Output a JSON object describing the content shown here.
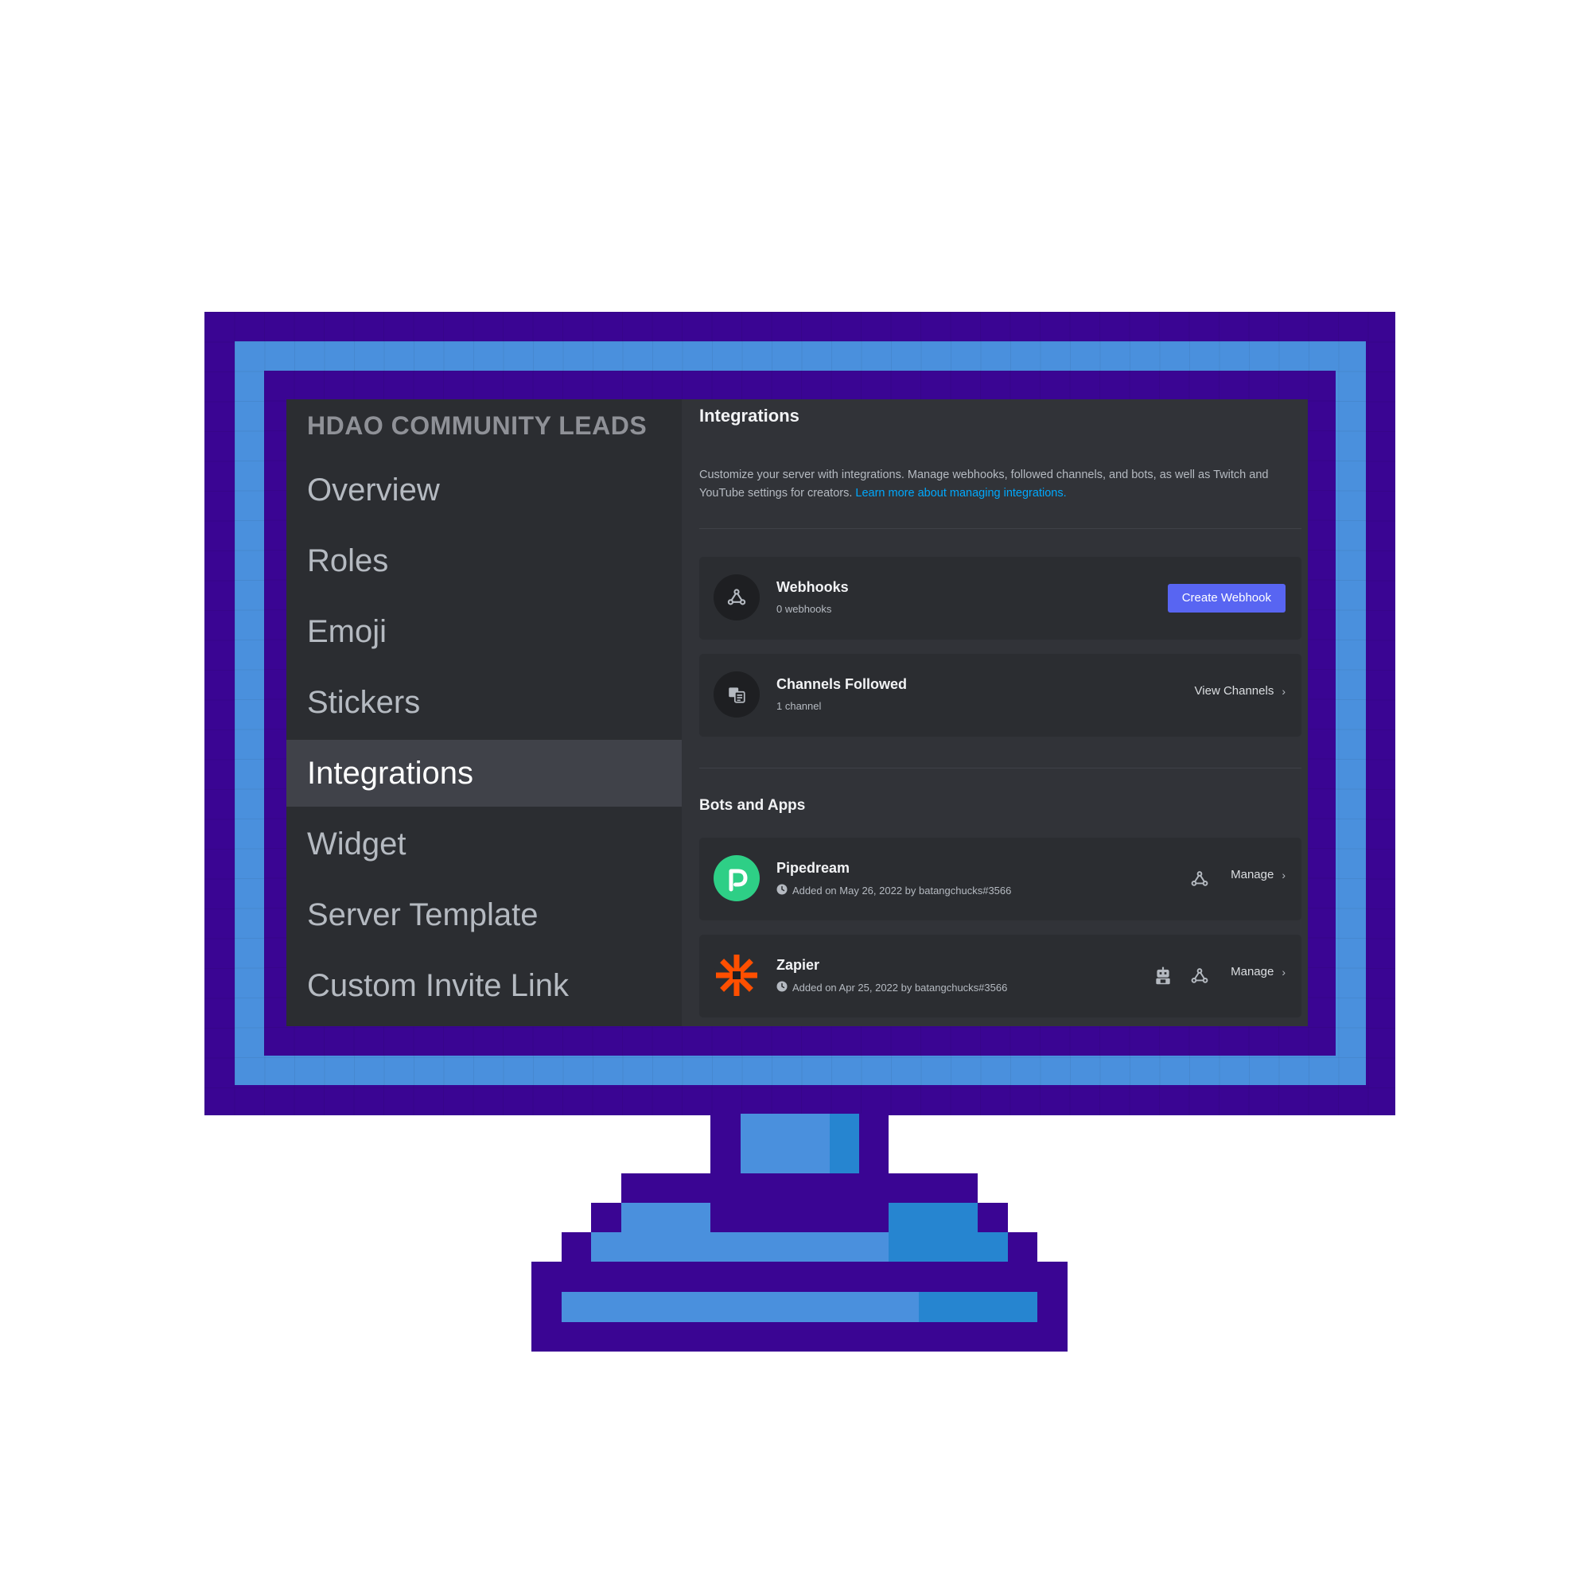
{
  "sidebar": {
    "server_name": "HDAO COMMUNITY LEADS",
    "items": [
      {
        "label": "Overview"
      },
      {
        "label": "Roles"
      },
      {
        "label": "Emoji"
      },
      {
        "label": "Stickers"
      },
      {
        "label": "Integrations",
        "active": true
      },
      {
        "label": "Widget"
      },
      {
        "label": "Server Template"
      },
      {
        "label": "Custom Invite Link"
      }
    ]
  },
  "main": {
    "title": "Integrations",
    "description": "Customize your server with integrations. Manage webhooks, followed channels, and bots, as well as Twitch and YouTube settings for creators.",
    "learn_more_link": "Learn more about managing integrations.",
    "webhooks": {
      "title": "Webhooks",
      "subtitle": "0 webhooks",
      "icon": "webhook-icon",
      "button_label": "Create Webhook"
    },
    "channels_followed": {
      "title": "Channels Followed",
      "subtitle": "1 channel",
      "icon": "channel-follow-icon",
      "action_label": "View Channels"
    },
    "bots_section_title": "Bots and Apps",
    "bots": [
      {
        "name": "Pipedream",
        "added": "Added on May 26, 2022 by batangchucks#3566",
        "avatar_icon": "pipedream-logo",
        "icons": [
          "webhook-icon"
        ],
        "action_label": "Manage"
      },
      {
        "name": "Zapier",
        "added": "Added on Apr 25, 2022 by batangchucks#3566",
        "avatar_icon": "zapier-logo",
        "icons": [
          "bot-icon",
          "webhook-icon"
        ],
        "action_label": "Manage"
      }
    ]
  },
  "colors": {
    "monitor_dark": "#3a0593",
    "monitor_blue": "#4a90dd",
    "monitor_blue_dark": "#2685d0",
    "accent": "#5865f2",
    "link": "#00a8fc",
    "pipedream_green": "#2ecf86",
    "zapier_orange": "#ff4f00"
  }
}
